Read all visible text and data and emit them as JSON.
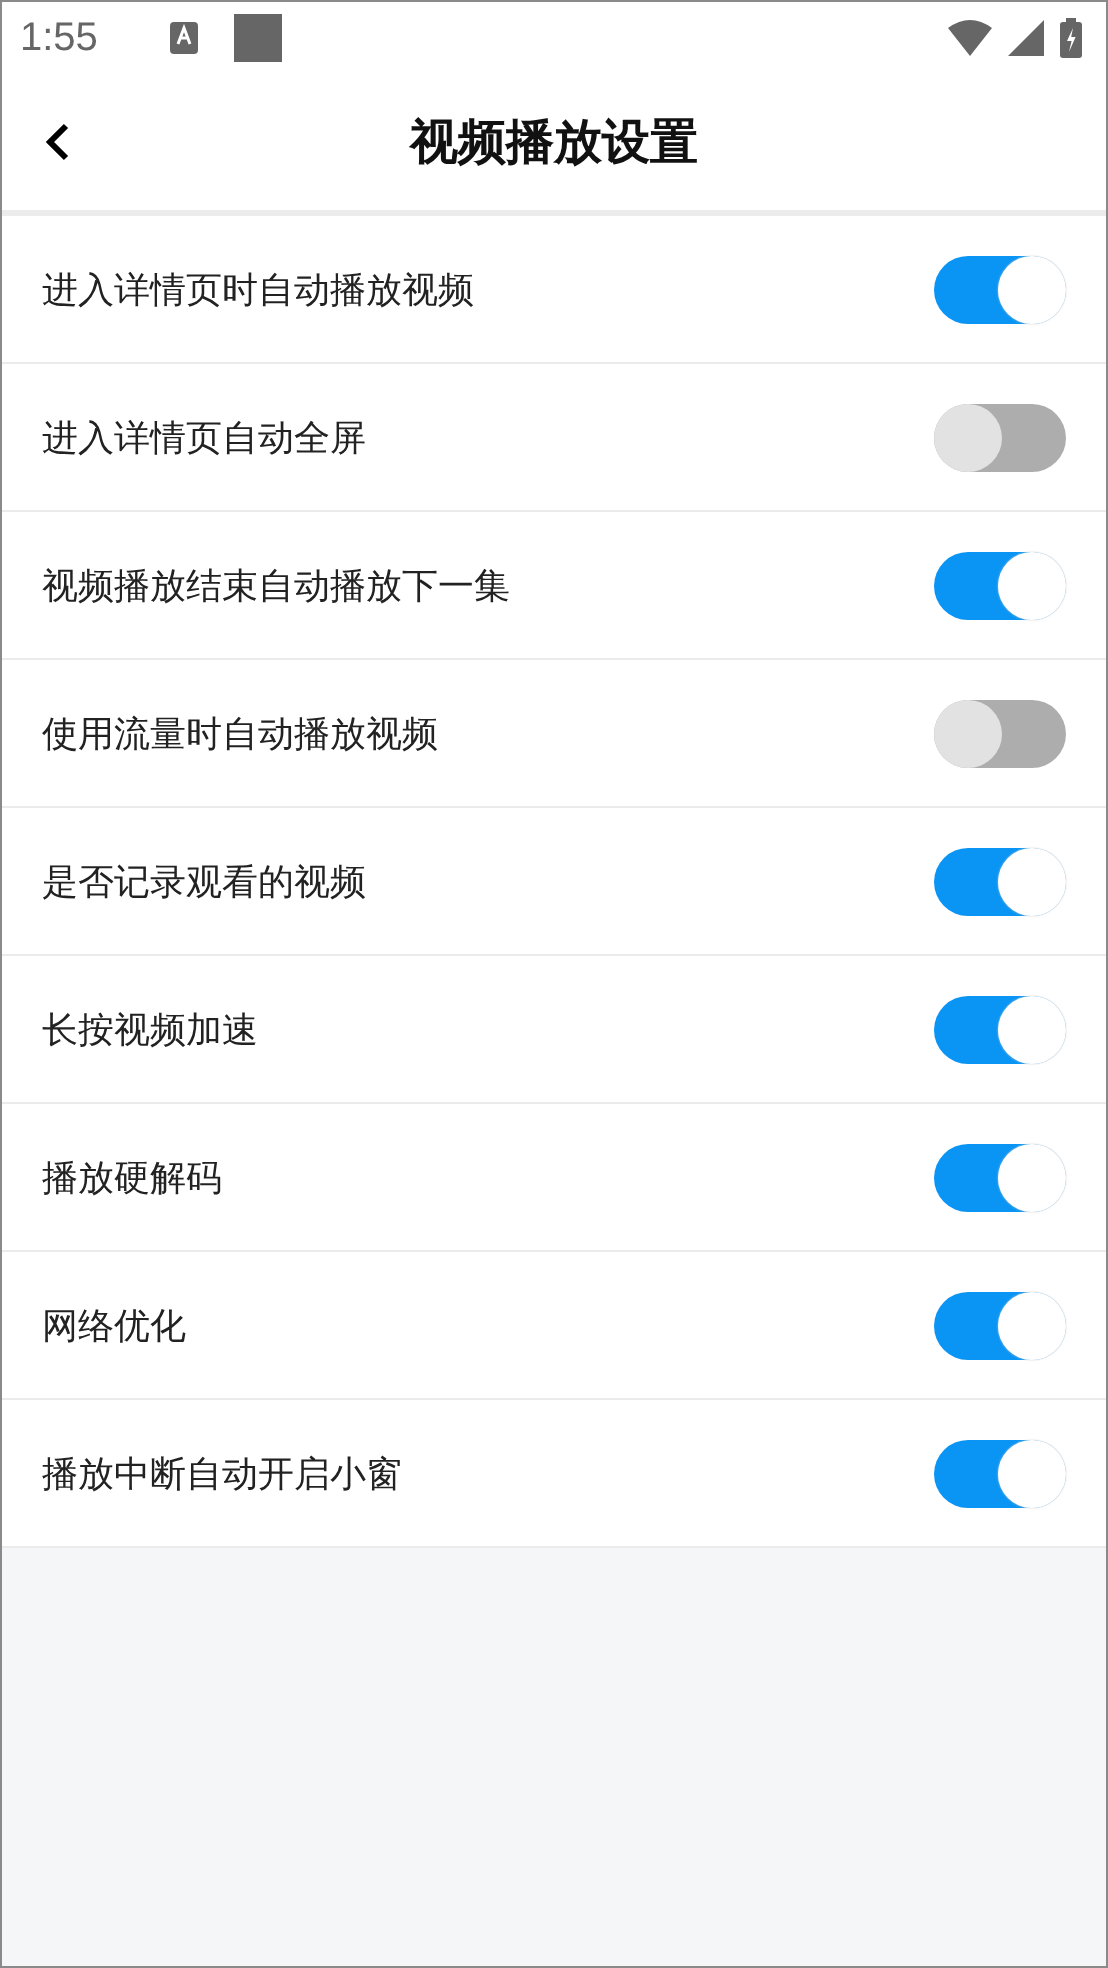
{
  "status_bar": {
    "time": "1:55"
  },
  "header": {
    "title": "视频播放设置"
  },
  "settings": [
    {
      "label": "进入详情页时自动播放视频",
      "on": true
    },
    {
      "label": "进入详情页自动全屏",
      "on": false
    },
    {
      "label": "视频播放结束自动播放下一集",
      "on": true
    },
    {
      "label": "使用流量时自动播放视频",
      "on": false
    },
    {
      "label": "是否记录观看的视频",
      "on": true
    },
    {
      "label": "长按视频加速",
      "on": true
    },
    {
      "label": "播放硬解码",
      "on": true
    },
    {
      "label": "网络优化",
      "on": true
    },
    {
      "label": "播放中断自动开启小窗",
      "on": true
    }
  ]
}
